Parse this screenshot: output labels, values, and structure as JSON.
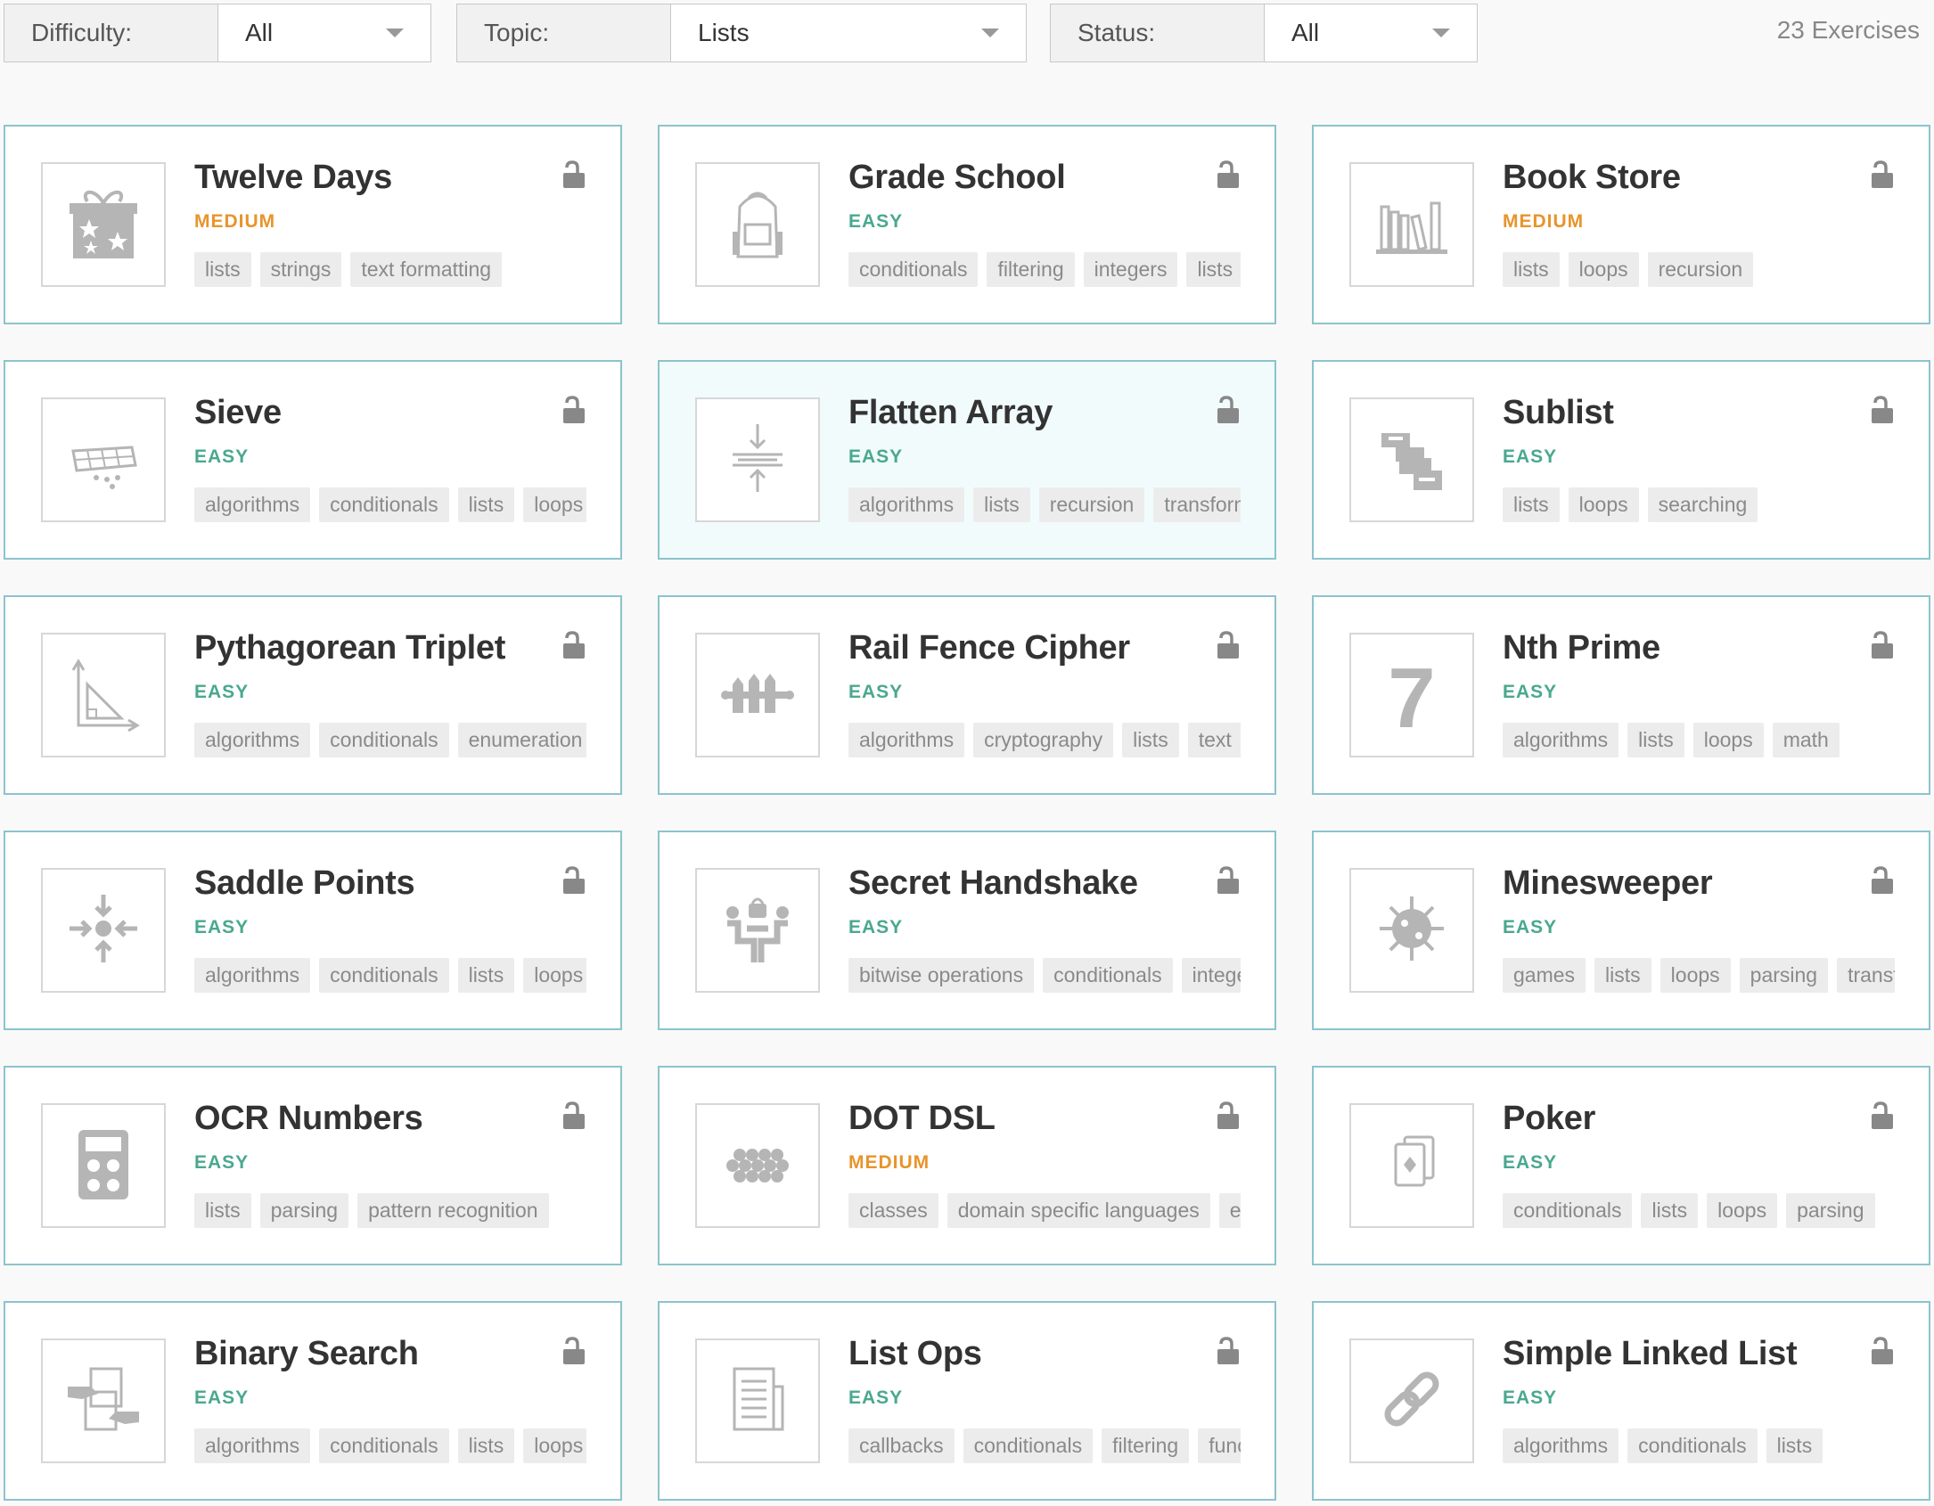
{
  "filters": {
    "difficulty": {
      "label": "Difficulty:",
      "value": "All"
    },
    "topic": {
      "label": "Topic:",
      "value": "Lists"
    },
    "status": {
      "label": "Status:",
      "value": "All"
    }
  },
  "exercise_count": "23 Exercises",
  "colors": {
    "card_border": "#8bc4cc",
    "easy": "#4aa88f",
    "medium": "#e8942b",
    "highlight_bg": "#f1fbfb"
  },
  "exercises": [
    {
      "title": "Twelve Days",
      "difficulty": "MEDIUM",
      "icon": "gift-icon",
      "tags": [
        "lists",
        "strings",
        "text formatting"
      ]
    },
    {
      "title": "Grade School",
      "difficulty": "EASY",
      "icon": "backpack-icon",
      "tags": [
        "conditionals",
        "filtering",
        "integers",
        "lists"
      ]
    },
    {
      "title": "Book Store",
      "difficulty": "MEDIUM",
      "icon": "bookshelf-icon",
      "tags": [
        "lists",
        "loops",
        "recursion"
      ]
    },
    {
      "title": "Sieve",
      "difficulty": "EASY",
      "icon": "sieve-icon",
      "tags": [
        "algorithms",
        "conditionals",
        "lists",
        "loops"
      ]
    },
    {
      "title": "Flatten Array",
      "difficulty": "EASY",
      "icon": "flatten-icon",
      "tags": [
        "algorithms",
        "lists",
        "recursion",
        "transforming"
      ],
      "highlighted": true
    },
    {
      "title": "Sublist",
      "difficulty": "EASY",
      "icon": "sublist-icon",
      "tags": [
        "lists",
        "loops",
        "searching"
      ]
    },
    {
      "title": "Pythagorean Triplet",
      "difficulty": "EASY",
      "icon": "triangle-icon",
      "tags": [
        "algorithms",
        "conditionals",
        "enumeration"
      ]
    },
    {
      "title": "Rail Fence Cipher",
      "difficulty": "EASY",
      "icon": "fence-icon",
      "tags": [
        "algorithms",
        "cryptography",
        "lists",
        "text"
      ]
    },
    {
      "title": "Nth Prime",
      "difficulty": "EASY",
      "icon": "seven-icon",
      "tags": [
        "algorithms",
        "lists",
        "loops",
        "math"
      ]
    },
    {
      "title": "Saddle Points",
      "difficulty": "EASY",
      "icon": "saddle-points-icon",
      "tags": [
        "algorithms",
        "conditionals",
        "lists",
        "loops"
      ]
    },
    {
      "title": "Secret Handshake",
      "difficulty": "EASY",
      "icon": "handshake-icon",
      "tags": [
        "bitwise operations",
        "conditionals",
        "integers"
      ]
    },
    {
      "title": "Minesweeper",
      "difficulty": "EASY",
      "icon": "mine-icon",
      "tags": [
        "games",
        "lists",
        "loops",
        "parsing",
        "transforming"
      ]
    },
    {
      "title": "OCR Numbers",
      "difficulty": "EASY",
      "icon": "calculator-icon",
      "tags": [
        "lists",
        "parsing",
        "pattern recognition"
      ]
    },
    {
      "title": "DOT DSL",
      "difficulty": "MEDIUM",
      "icon": "dots-icon",
      "tags": [
        "classes",
        "domain specific languages",
        "equality"
      ]
    },
    {
      "title": "Poker",
      "difficulty": "EASY",
      "icon": "cards-icon",
      "tags": [
        "conditionals",
        "lists",
        "loops",
        "parsing"
      ]
    },
    {
      "title": "Binary Search",
      "difficulty": "EASY",
      "icon": "binary-search-icon",
      "tags": [
        "algorithms",
        "conditionals",
        "lists",
        "loops"
      ]
    },
    {
      "title": "List Ops",
      "difficulty": "EASY",
      "icon": "document-icon",
      "tags": [
        "callbacks",
        "conditionals",
        "filtering",
        "functions"
      ]
    },
    {
      "title": "Simple Linked List",
      "difficulty": "EASY",
      "icon": "chain-link-icon",
      "tags": [
        "algorithms",
        "conditionals",
        "lists"
      ]
    }
  ]
}
